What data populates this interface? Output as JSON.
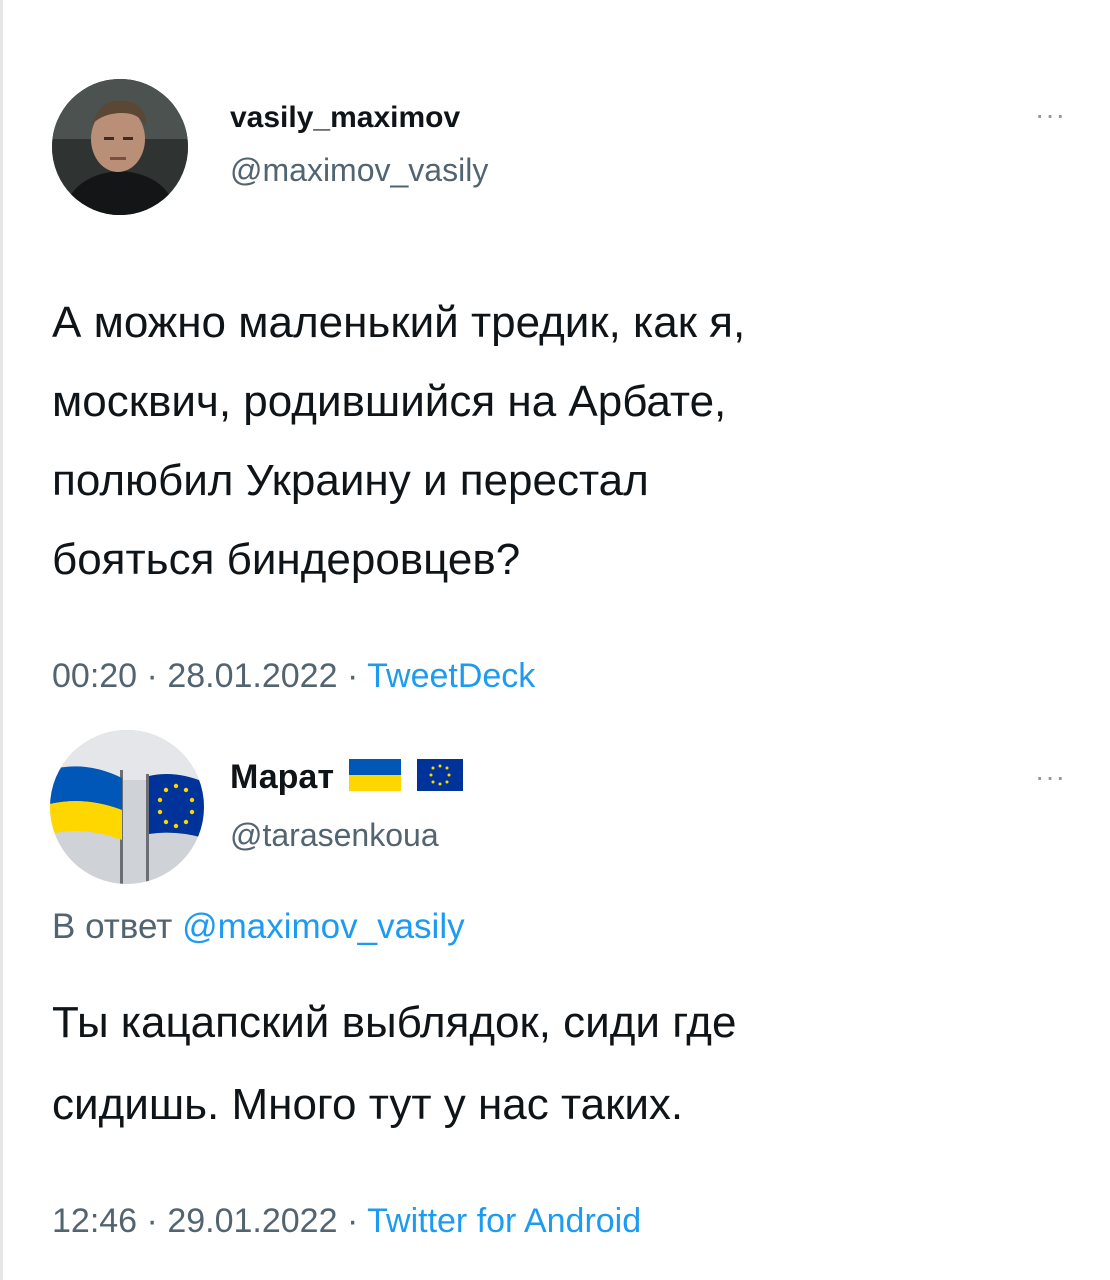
{
  "tweet1": {
    "display_name": "vasily_maximov",
    "handle": "@maximov_vasily",
    "more_label": "···",
    "text_lines": [
      "А можно маленький тредик, как я,",
      "москвич, родившийся на Арбате,",
      "полюбил Украину и перестал",
      "бояться биндеровцев?"
    ],
    "time": "00:20",
    "date": "28.01.2022",
    "source": "TweetDeck",
    "separator": "·"
  },
  "tweet2": {
    "display_name": "Марат",
    "handle": "@tarasenkoua",
    "more_label": "···",
    "reply_prefix": "В ответ",
    "reply_handle": "@maximov_vasily",
    "text_lines": [
      "Ты кацапский выблядок, сиди где",
      "сидишь. Много тут у нас таких."
    ],
    "time": "12:46",
    "date": "29.01.2022",
    "source": "Twitter for Android",
    "separator": "·",
    "flags": [
      "ukraine-flag",
      "eu-flag"
    ]
  },
  "colors": {
    "text": "#0f1419",
    "secondary": "#536471",
    "link": "#1d9bf0",
    "ukraine_blue": "#0057b7",
    "ukraine_yellow": "#ffd700",
    "eu_blue": "#003399"
  }
}
